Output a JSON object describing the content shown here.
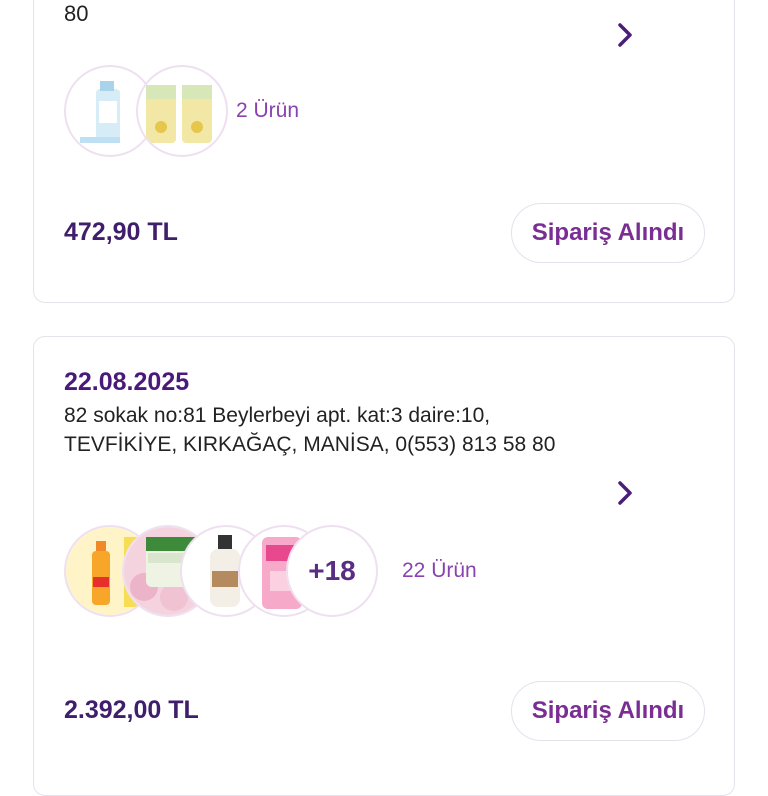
{
  "orders": [
    {
      "address_tail": "80",
      "item_count": "2 Ürün",
      "price": "472,90 TL",
      "status": "Sipariş Alındı",
      "product_icons": [
        "spray-bottle-icon",
        "cream-tube-icon"
      ]
    },
    {
      "date": "22.08.2025",
      "address": "82 sokak no:81 Beylerbeyi apt. kat:3 daire:10, TEVFİKİYE, KIRKAĞAÇ, MANİSA, 0(553) 813 58 80",
      "more_items": "+18",
      "item_count": "22 Ürün",
      "price": "2.392,00 TL",
      "status": "Sipariş Alındı",
      "product_icons": [
        "spray-bottle-icon",
        "soap-icon",
        "lotion-bottle-icon",
        "shampoo-bottle-icon"
      ]
    }
  ],
  "colors": {
    "accent": "#5a2d82",
    "price": "#3f1f6b",
    "status_text": "#7a2d92",
    "count_text": "#8a42b0"
  }
}
